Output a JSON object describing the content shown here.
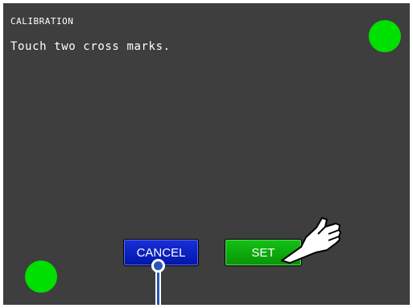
{
  "screen": {
    "title": "CALIBRATION",
    "instruction": "Touch two cross marks."
  },
  "buttons": {
    "cancel_label": "CANCEL",
    "set_label": "SET"
  },
  "marks": [
    "top-right-mark",
    "bottom-left-mark"
  ],
  "colors": {
    "background": "#3e3e3e",
    "mark": "#00e000",
    "cancel": "#0016a8",
    "set": "#089408"
  },
  "icons": {
    "pointer": "hand-pointer-icon",
    "callout": "callout-pin-icon"
  }
}
